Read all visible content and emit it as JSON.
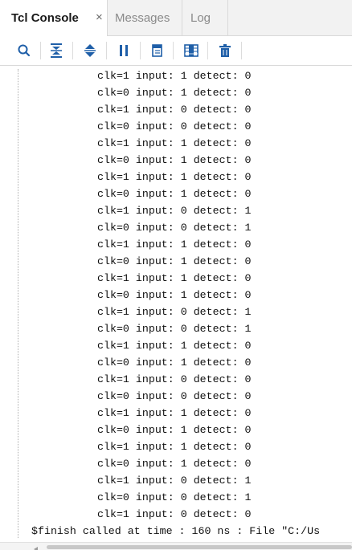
{
  "tabs": [
    {
      "label": "Tcl Console",
      "active": true,
      "close_glyph": "×"
    },
    {
      "label": "Messages",
      "active": false
    },
    {
      "label": "Log",
      "active": false
    }
  ],
  "toolbar": {
    "icons": [
      "search-icon",
      "collapse-all-icon",
      "expand-all-icon",
      "pause-icon",
      "copy-icon",
      "columns-icon",
      "delete-icon"
    ]
  },
  "console": {
    "lines": [
      "clk=1 input: 1 detect: 0",
      "clk=0 input: 1 detect: 0",
      "clk=1 input: 0 detect: 0",
      "clk=0 input: 0 detect: 0",
      "clk=1 input: 1 detect: 0",
      "clk=0 input: 1 detect: 0",
      "clk=1 input: 1 detect: 0",
      "clk=0 input: 1 detect: 0",
      "clk=1 input: 0 detect: 1",
      "clk=0 input: 0 detect: 1",
      "clk=1 input: 1 detect: 0",
      "clk=0 input: 1 detect: 0",
      "clk=1 input: 1 detect: 0",
      "clk=0 input: 1 detect: 0",
      "clk=1 input: 0 detect: 1",
      "clk=0 input: 0 detect: 1",
      "clk=1 input: 1 detect: 0",
      "clk=0 input: 1 detect: 0",
      "clk=1 input: 0 detect: 0",
      "clk=0 input: 0 detect: 0",
      "clk=1 input: 1 detect: 0",
      "clk=0 input: 1 detect: 0",
      "clk=1 input: 1 detect: 0",
      "clk=0 input: 1 detect: 0",
      "clk=1 input: 0 detect: 1",
      "clk=0 input: 0 detect: 1",
      "clk=1 input: 0 detect: 0"
    ],
    "finish_line": "$finish called at time : 160 ns : File \"C:/Us"
  },
  "colors": {
    "tab_bar_bg": "#f2f2f2",
    "icon_blue": "#1f5fa8",
    "text": "#111111"
  }
}
